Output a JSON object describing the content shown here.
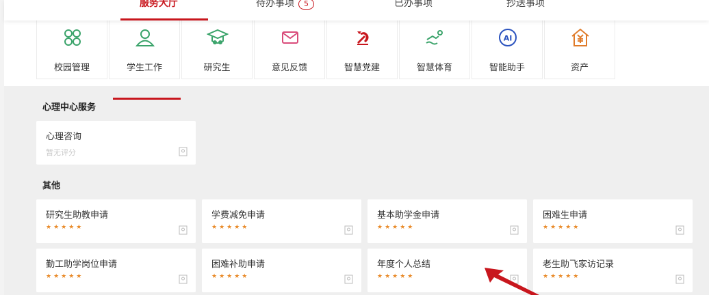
{
  "tabs": [
    {
      "label": "服务大厅",
      "active": true
    },
    {
      "label": "待办事项",
      "badge": "5",
      "active": false
    },
    {
      "label": "已办事项",
      "active": false
    },
    {
      "label": "抄送事项",
      "active": false
    }
  ],
  "categories": [
    {
      "label": "校园管理",
      "icon": "campus-grid-icon"
    },
    {
      "label": "学生工作",
      "icon": "student-user-icon",
      "active": true
    },
    {
      "label": "研究生",
      "icon": "graduate-cap-icon"
    },
    {
      "label": "意见反馈",
      "icon": "envelope-icon"
    },
    {
      "label": "智慧党建",
      "icon": "party-emblem-icon"
    },
    {
      "label": "智慧体育",
      "icon": "swimmer-icon"
    },
    {
      "label": "智能助手",
      "icon": "ai-assistant-icon"
    },
    {
      "label": "资产",
      "icon": "yuan-house-icon"
    }
  ],
  "sections": [
    {
      "title": "心理中心服务",
      "cards": [
        {
          "name": "心理咨询",
          "rating_text": "暂无评分"
        }
      ]
    },
    {
      "title": "其他",
      "cards": [
        {
          "name": "研究生助教申请",
          "stars": "★★★★★"
        },
        {
          "name": "学费减免申请",
          "stars": "★★★★★"
        },
        {
          "name": "基本助学金申请",
          "stars": "★★★★★"
        },
        {
          "name": "困难生申请",
          "stars": "★★★★★"
        },
        {
          "name": "勤工助学岗位申请",
          "stars": "★★★★★"
        },
        {
          "name": "困难补助申请",
          "stars": "★★★★★"
        },
        {
          "name": "年度个人总结",
          "stars": "★★★★★"
        },
        {
          "name": "老生助飞家访记录",
          "stars": "★★★★★"
        }
      ]
    }
  ],
  "colors": {
    "accent": "#c8161d",
    "star": "#e98b2a",
    "icon_green": "#3aa36a",
    "icon_pink": "#d94b7a",
    "icon_blue": "#2a52be",
    "icon_orange": "#e07b2a"
  }
}
